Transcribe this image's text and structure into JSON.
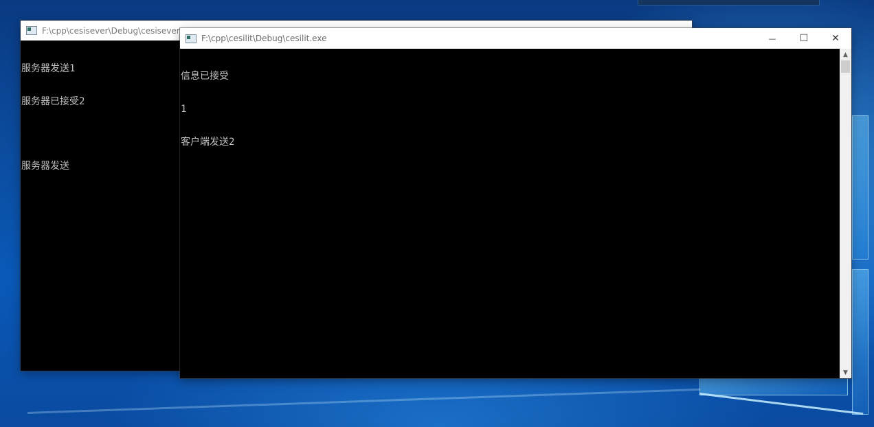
{
  "colors": {
    "console_bg": "#000000",
    "console_text": "#c0c0c0",
    "titlebar_bg": "#ffffff",
    "desktop_blue": "#0a59b8"
  },
  "server_window": {
    "title": "F:\\cpp\\cesisever\\Debug\\cesisever.exe",
    "icon": "console-app-icon",
    "lines": [
      "服务器发送1",
      "服务器已接受2",
      "",
      "服务器发送"
    ]
  },
  "client_window": {
    "title": "F:\\cpp\\cesilit\\Debug\\cesilit.exe",
    "icon": "console-app-icon",
    "lines": [
      "信息已接受",
      "1",
      "客户端发送2"
    ],
    "controls": {
      "minimize_glyph": "—",
      "maximize_glyph": "☐",
      "close_glyph": "✕"
    },
    "scrollbar": {
      "up_glyph": "▲",
      "down_glyph": "▼"
    }
  }
}
